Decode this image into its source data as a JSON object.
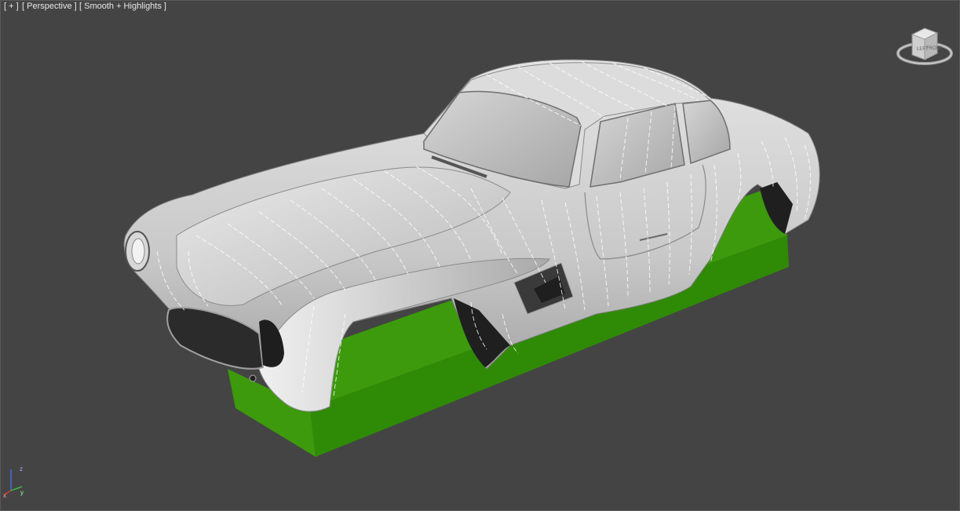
{
  "viewport": {
    "labels": {
      "plus_menu": "[ + ]",
      "view_menu": "[ Perspective ]",
      "shading_menu": "[ Smooth + Highlights ]"
    },
    "background_color": "#444444"
  },
  "scene": {
    "objects": [
      {
        "name": "car-body",
        "color": "#c8c8c8"
      },
      {
        "name": "base-box",
        "color": "#3d9b0a"
      }
    ]
  },
  "viewcube": {
    "faces": {
      "left": "LEFT",
      "front": "FRONT"
    },
    "icon": "viewcube-icon"
  },
  "axis_tripod": {
    "x": "x",
    "y": "y",
    "z": "z",
    "colors": {
      "x": "#d83b3b",
      "y": "#3bb83b",
      "z": "#4a6bd8"
    }
  }
}
